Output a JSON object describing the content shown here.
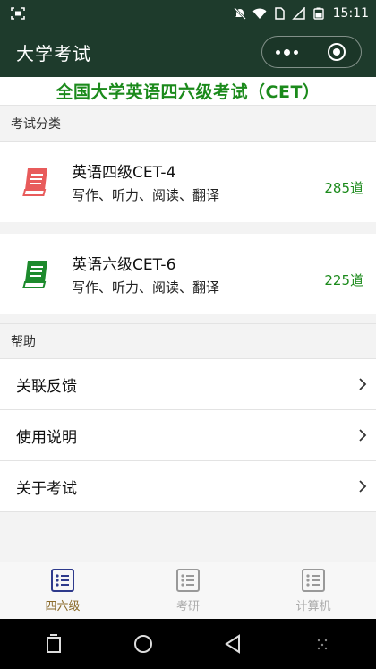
{
  "status": {
    "time": "15:11"
  },
  "nav": {
    "title": "大学考试"
  },
  "banner": {
    "text": "全国大学英语四六级考试（CET）"
  },
  "sections": {
    "category": "考试分类",
    "help": "帮助"
  },
  "exams": [
    {
      "title": "英语四级CET-4",
      "subtitle": "写作、听力、阅读、翻译",
      "count": "285道",
      "icon": "red-book-icon",
      "color": "#e85b5b"
    },
    {
      "title": "英语六级CET-6",
      "subtitle": "写作、听力、阅读、翻译",
      "count": "225道",
      "icon": "green-book-icon",
      "color": "#1c8a2c"
    }
  ],
  "help_items": [
    {
      "label": "关联反馈"
    },
    {
      "label": "使用说明"
    },
    {
      "label": "关于考试"
    }
  ],
  "tabs": [
    {
      "label": "四六级",
      "active": true
    },
    {
      "label": "考研",
      "active": false
    },
    {
      "label": "计算机",
      "active": false
    }
  ],
  "colors": {
    "header": "#1e3b2c",
    "accent_green": "#1b8a1b",
    "tab_active": "#2e3a8c",
    "tab_active_label": "#8a6a2a",
    "tab_inactive": "#aaaaaa"
  }
}
